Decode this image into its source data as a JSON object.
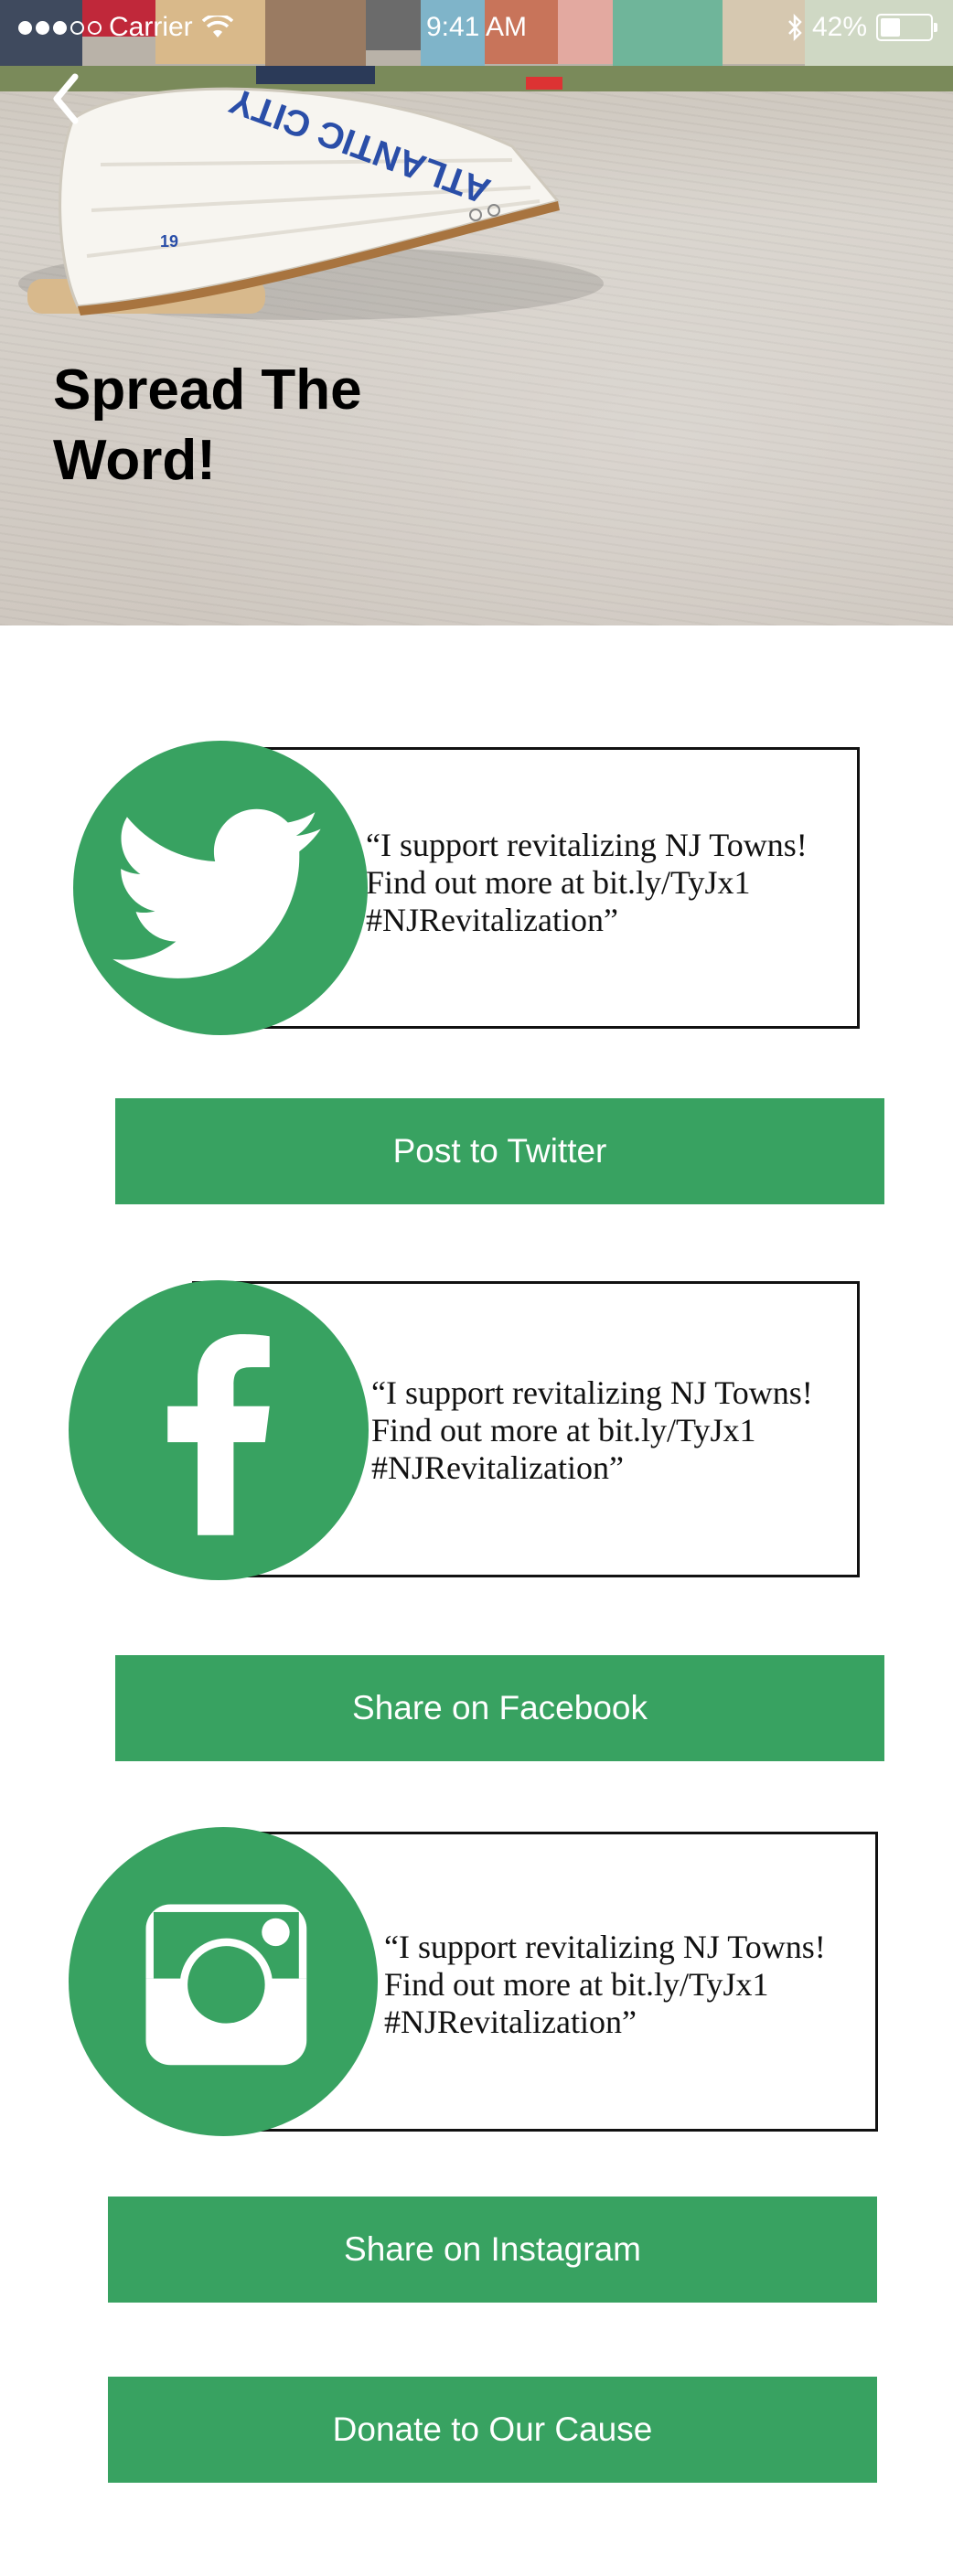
{
  "status_bar": {
    "carrier": "Carrier",
    "time": "9:41 AM",
    "battery": "42%",
    "battery_level": 0.42
  },
  "header": {
    "title": "Spread The Word!"
  },
  "hero_image": {
    "boat_lettering": "ATLANTIC CITY",
    "boat_number": "19"
  },
  "share_cards": [
    {
      "network": "twitter",
      "icon": "twitter-bird-icon",
      "quote_lines": [
        "“I support revitalizing NJ Towns!",
        "Find out more at bit.ly/TyJx1",
        "#NJRevitalization”"
      ],
      "button_label": "Post to Twitter"
    },
    {
      "network": "facebook",
      "icon": "facebook-f-icon",
      "quote_lines": [
        "“I support revitalizing NJ Towns!",
        "Find out more at bit.ly/TyJx1",
        "#NJRevitalization”"
      ],
      "button_label": "Share on Facebook"
    },
    {
      "network": "instagram",
      "icon": "instagram-camera-icon",
      "quote_lines": [
        "“I support revitalizing NJ Towns!",
        "Find out more at bit.ly/TyJx1",
        "#NJRevitalization”"
      ],
      "button_label": "Share on Instagram"
    }
  ],
  "donate": {
    "button_label": "Donate to Our Cause"
  },
  "colors": {
    "accent_green": "#38a261",
    "background": "#ffffff",
    "text": "#111111"
  }
}
